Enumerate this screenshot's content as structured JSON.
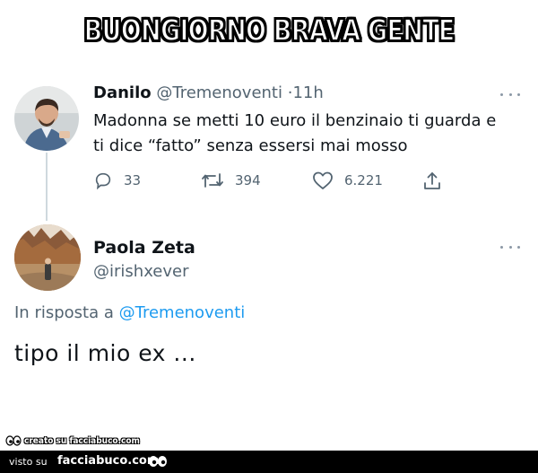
{
  "meme": {
    "caption": "BUONGIORNO BRAVA GENTE"
  },
  "tweet": {
    "author_name": "Danilo",
    "author_handle": "@Tremenoventi",
    "separator": "·",
    "time": "11h",
    "text_line1": "Madonna se metti 10 euro il benzinaio ti guarda e",
    "text_line2": "ti dice “fatto” senza essersi mai mosso",
    "replies": "33",
    "retweets": "394",
    "likes": "6.221",
    "icons": [
      "reply-icon",
      "retweet-icon",
      "like-icon",
      "share-icon",
      "more-icon"
    ]
  },
  "reply": {
    "author_name": "Paola Zeta",
    "author_handle": "@irishxever",
    "replying_prefix": "In risposta a",
    "replying_to": "@Tremenoventi",
    "text": "tipo il mio ex ..."
  },
  "colors": {
    "link": "#1d9bf0",
    "muted": "#536471",
    "thread_line": "#cfd9de"
  },
  "footer": {
    "watermark": "creato su facciabuco.com",
    "visto_su": "visto su",
    "site": "facciabuco.com"
  }
}
